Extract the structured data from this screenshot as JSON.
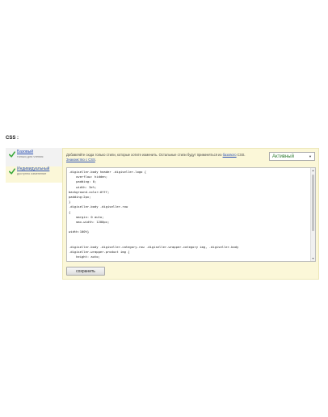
{
  "section_label": "CSS :",
  "sidebar": {
    "items": [
      {
        "title": "Базовый",
        "subtitle": "только для чтения",
        "icon": "checkmark-icon"
      },
      {
        "title": "Индивидуальный",
        "subtitle": "доступно изменение",
        "icon": "checkmark-icon"
      }
    ]
  },
  "editor": {
    "hint_prefix": "Добавляйте сюда только стили, которые хотите изменить. Остальные стили будут применяться из",
    "hint_link_base": "базового",
    "hint_mid": " CSS. ",
    "hint_link_intro": "Знакомство с CSS",
    "hint_suffix": ".",
    "status": {
      "value": "Активный"
    },
    "code": ".digiseller-body header .digiseller-logo {\n    overflow: hidden;\n    padding: 0;\n    width: 3e%;\nbackground-color:#fff;\npadding:2px;\n}\n.digiseller-body .digiseller-row\n{\n    margin: 0 auto;\n    max-width: 1200px;\n\nwidth:100%}\n\n\n.digiseller-body .digiseller-category-row .digiseller-wrapper-category img, .digiseller-body\n.digiseller-wrapper-product img {\n    height: auto;\n    width: auto;\n    position: absolute;",
    "save_label": "сохранить"
  },
  "colors": {
    "panel_bg": "#fbf7d8",
    "link": "#2a4fb3",
    "status": "#2c7a2c",
    "check": "#3aa83a"
  }
}
